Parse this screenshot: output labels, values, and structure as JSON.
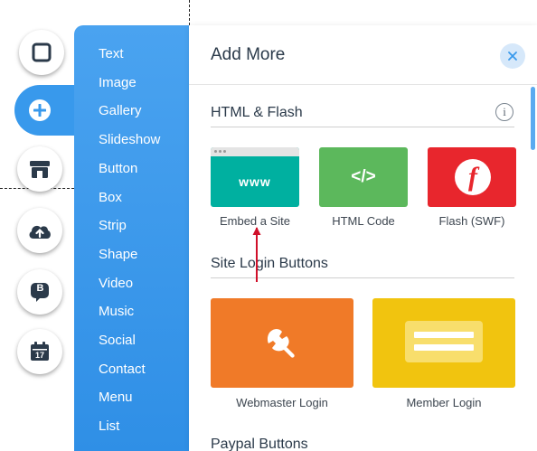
{
  "categories": [
    "Text",
    "Image",
    "Gallery",
    "Slideshow",
    "Button",
    "Box",
    "Strip",
    "Shape",
    "Video",
    "Music",
    "Social",
    "Contact",
    "Menu",
    "List"
  ],
  "panel": {
    "title": "Add More",
    "sections": {
      "html_flash": "HTML & Flash",
      "site_login": "Site Login Buttons",
      "paypal": "Paypal Buttons"
    },
    "info_glyph": "i",
    "tiles": {
      "embed": {
        "label": "Embed a Site",
        "glyph": "www"
      },
      "html_code": {
        "label": "HTML Code",
        "glyph": "</>"
      },
      "flash": {
        "label": "Flash (SWF)",
        "glyph": "f"
      },
      "webmaster": {
        "label": "Webmaster Login"
      },
      "member": {
        "label": "Member Login"
      }
    }
  },
  "rail": {
    "badge_letter": "B",
    "calendar_day": "17"
  },
  "colors": {
    "menu_blue": "#3899ec",
    "embed_teal": "#00b0a0",
    "html_green": "#5cb85c",
    "flash_red": "#e8262d",
    "webmaster_orange": "#f07a28",
    "member_yellow": "#f1c40f",
    "annotation_arrow": "#d0102a"
  },
  "icons": [
    "square-icon",
    "plus-icon",
    "store-icon",
    "upload-cloud-icon",
    "blog-b-icon",
    "calendar-icon",
    "close-icon",
    "info-icon",
    "wrench-icon",
    "login-card-icon"
  ]
}
